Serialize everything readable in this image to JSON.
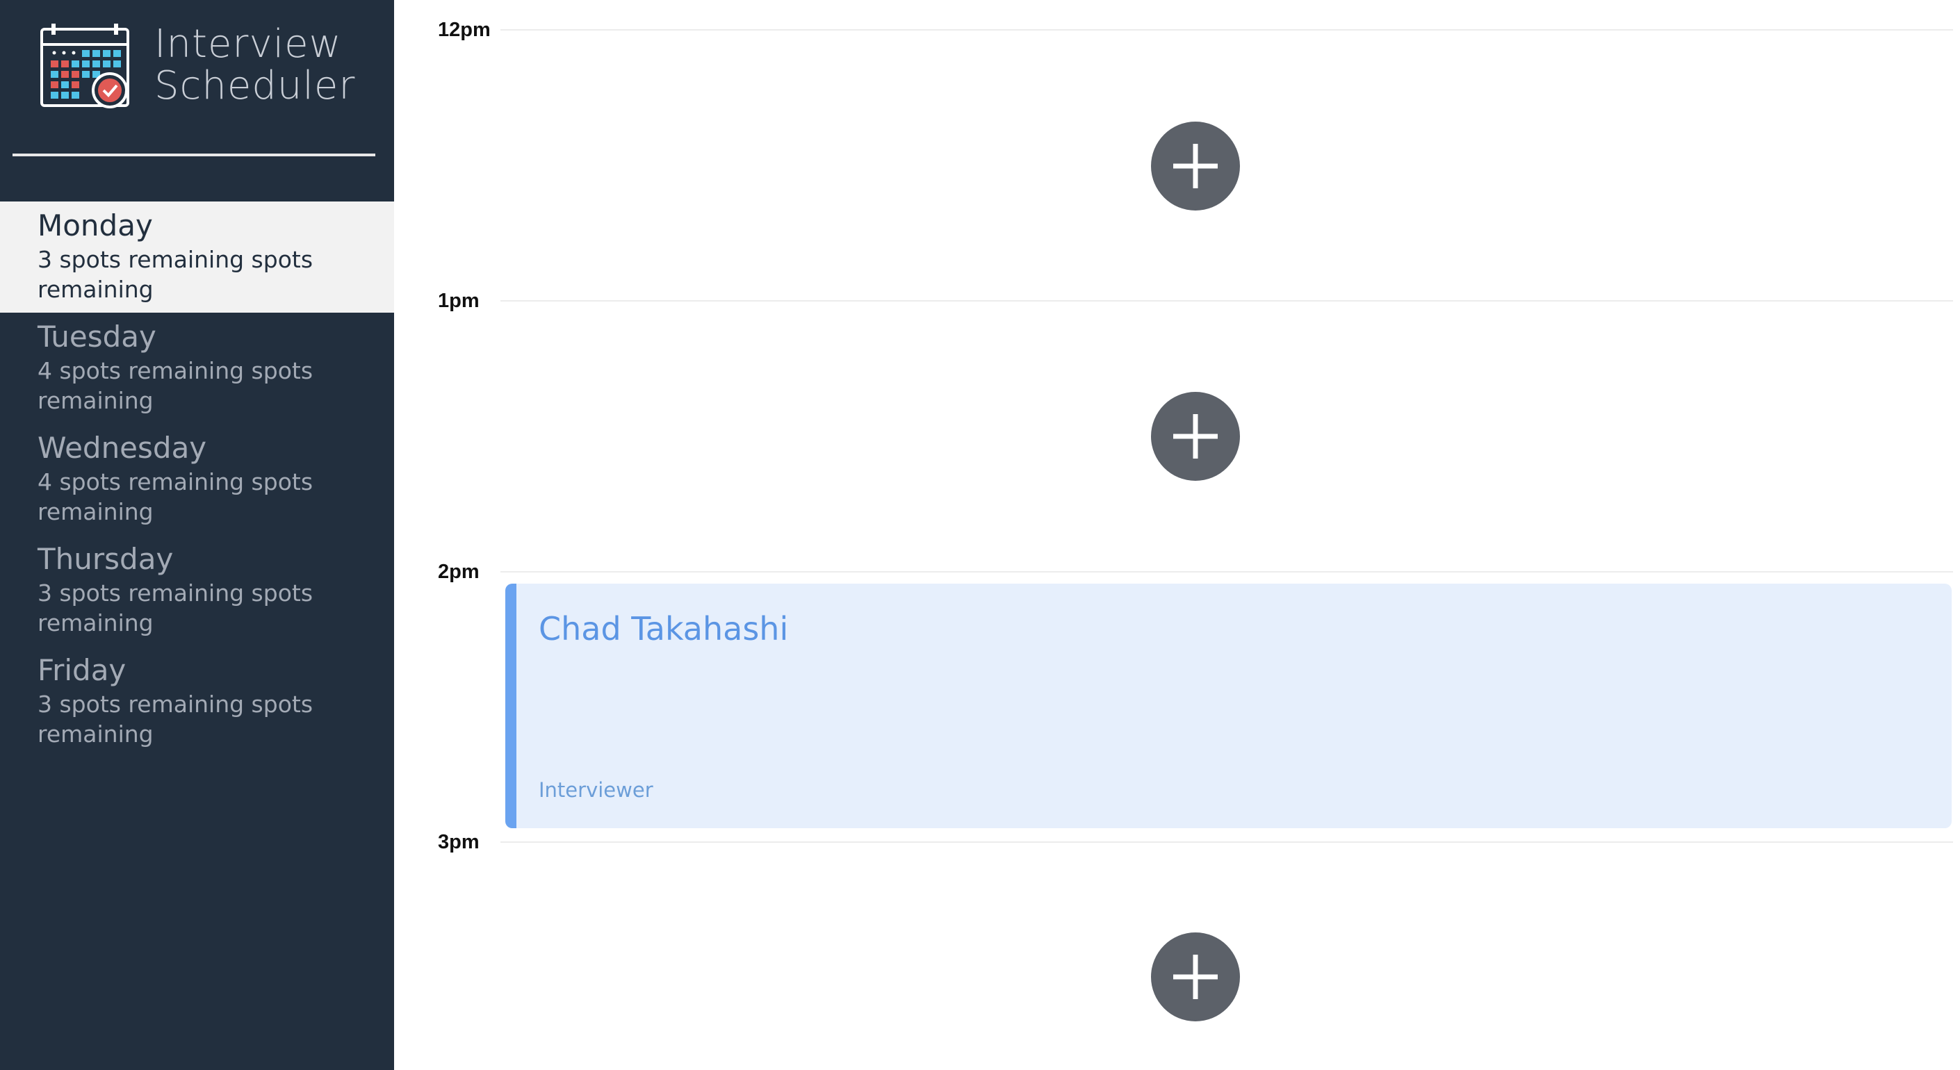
{
  "app": {
    "title_line1": "Interview",
    "title_line2": "Scheduler"
  },
  "days": [
    {
      "name": "Monday",
      "spots": "3 spots remaining spots remaining",
      "selected": true
    },
    {
      "name": "Tuesday",
      "spots": "4 spots remaining spots remaining",
      "selected": false
    },
    {
      "name": "Wednesday",
      "spots": "4 spots remaining spots remaining",
      "selected": false
    },
    {
      "name": "Thursday",
      "spots": "3 spots remaining spots remaining",
      "selected": false
    },
    {
      "name": "Friday",
      "spots": "3 spots remaining spots remaining",
      "selected": false
    }
  ],
  "schedule": {
    "times": [
      "12pm",
      "1pm",
      "2pm",
      "3pm"
    ],
    "appointment": {
      "student": "Chad Takahashi",
      "interviewer_label": "Interviewer"
    }
  },
  "colors": {
    "sidebar_bg": "#222f3e",
    "selected_bg": "#f2f2f2",
    "add_button": "#5c6169",
    "appointment_bg": "#e6effc",
    "appointment_accent": "#6aa3f0"
  },
  "icons": {
    "logo": "calendar-check-icon",
    "add": "plus-icon"
  }
}
